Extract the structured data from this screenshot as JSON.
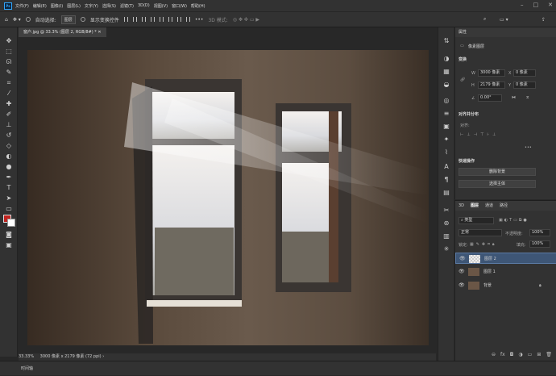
{
  "menu": {
    "items": [
      "文件(F)",
      "编辑(E)",
      "图像(I)",
      "图层(L)",
      "文字(Y)",
      "选择(S)",
      "滤镜(T)",
      "3D(D)",
      "视图(V)",
      "窗口(W)",
      "帮助(H)"
    ]
  },
  "options": {
    "auto_select": "自动选择:",
    "layer_select": "图层",
    "show_transform": "显示变换控件",
    "mode_3d": "3D 模式:"
  },
  "document": {
    "tab": "窗户.jpg @ 33.3% (图层 2, RGB/8#) *",
    "zoom": "33.33%",
    "info": "3000 像素 x 2179 像素 (72 ppi)"
  },
  "timeline": {
    "label": "时间轴"
  },
  "properties": {
    "title": "属性",
    "kind": "像素图层",
    "transform": "变换",
    "w_label": "W",
    "w_value": "3000 像素",
    "x_label": "X",
    "x_value": "0 像素",
    "h_label": "H",
    "h_value": "2179 像素",
    "y_label": "Y",
    "y_value": "0 像素",
    "angle": "0.00°",
    "align": "对齐并分布",
    "align_sub": "对齐:",
    "quick": "快速操作",
    "remove_bg": "删除背景",
    "select_subject": "选择主体"
  },
  "layers": {
    "tabs": [
      "3D",
      "图层",
      "通道",
      "路径"
    ],
    "filter": "类型",
    "mode": "正常",
    "opacity_label": "不透明度:",
    "opacity": "100%",
    "lock_label": "锁定:",
    "fill_label": "填充:",
    "fill": "100%",
    "items": [
      {
        "name": "图层 2",
        "selected": true
      },
      {
        "name": "图层 1",
        "selected": false
      },
      {
        "name": "背景",
        "selected": false
      }
    ]
  },
  "colors": {
    "foreground": "#c0231f",
    "background": "#ffffff",
    "accent": "#31a8ff"
  }
}
